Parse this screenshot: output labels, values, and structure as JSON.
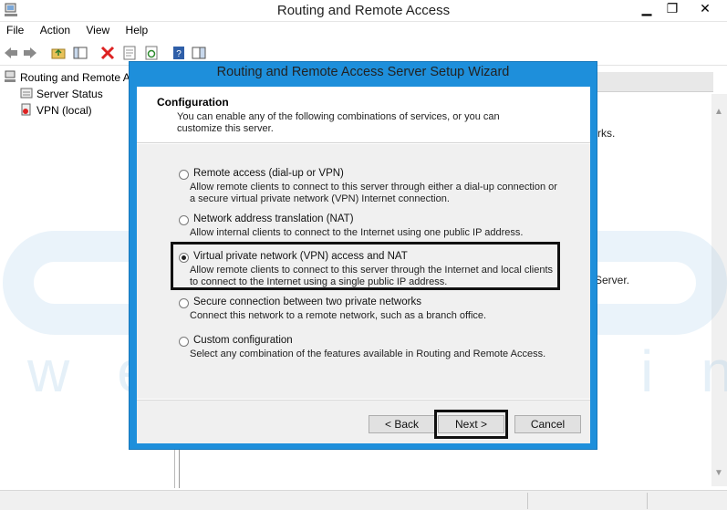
{
  "window": {
    "title": "Routing and Remote Access",
    "minimize": "▁",
    "restore": "❐",
    "close": "✕"
  },
  "menu": [
    "File",
    "Action",
    "View",
    "Help"
  ],
  "tree": {
    "root": "Routing and Remote A",
    "items": [
      "Server Status",
      "VPN (local)"
    ]
  },
  "right_pane": {
    "fragments": [
      "rks.",
      "Server."
    ]
  },
  "watermark": {
    "text": "web hosting"
  },
  "wizard": {
    "title": "Routing and Remote Access Server Setup Wizard",
    "header_title": "Configuration",
    "header_desc": "You can enable any of the following combinations of services, or you can customize this server.",
    "options": [
      {
        "label": "Remote access (dial-up or VPN)",
        "desc": "Allow remote clients to connect to this server through either a dial-up connection or a secure virtual private network (VPN) Internet connection.",
        "checked": false
      },
      {
        "label": "Network address translation (NAT)",
        "desc": "Allow internal clients to connect to the Internet using one public IP address.",
        "checked": false
      },
      {
        "label": "Virtual private network (VPN) access and NAT",
        "desc": "Allow remote clients to connect to this server through the Internet and local clients to connect to the Internet using a single public IP address.",
        "checked": true
      },
      {
        "label": "Secure connection between two private networks",
        "desc": "Connect this network to a remote network, such as a branch office.",
        "checked": false
      },
      {
        "label": "Custom configuration",
        "desc": "Select any combination of the features available in Routing and Remote Access.",
        "checked": false
      }
    ],
    "buttons": {
      "back": "< Back",
      "next": "Next >",
      "cancel": "Cancel"
    }
  },
  "colors": {
    "wizard_frame": "#1e8fdb",
    "highlight": "#111111"
  }
}
